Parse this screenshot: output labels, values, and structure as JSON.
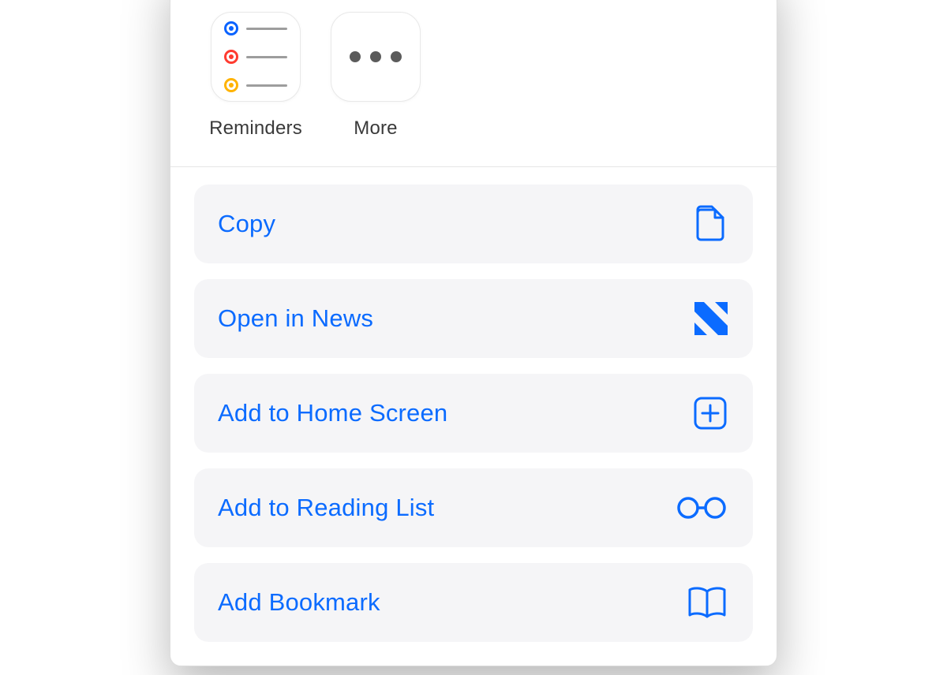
{
  "apps": [
    {
      "id": "reminders",
      "label": "Reminders"
    },
    {
      "id": "more",
      "label": "More"
    }
  ],
  "actions": [
    {
      "id": "copy",
      "label": "Copy",
      "icon": "copy-icon"
    },
    {
      "id": "open-in-news",
      "label": "Open in News",
      "icon": "news-icon"
    },
    {
      "id": "add-home-screen",
      "label": "Add to Home Screen",
      "icon": "plus-square-icon"
    },
    {
      "id": "add-reading-list",
      "label": "Add to Reading List",
      "icon": "glasses-icon"
    },
    {
      "id": "add-bookmark",
      "label": "Add Bookmark",
      "icon": "book-icon"
    }
  ],
  "colors": {
    "accent": "#0b6bff",
    "pill_bg": "#f5f5f7"
  }
}
